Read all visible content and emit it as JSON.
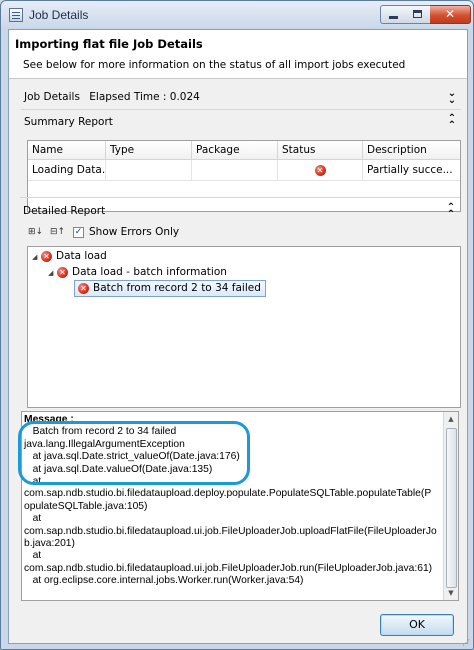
{
  "window": {
    "title": "Job Details"
  },
  "header": {
    "title": "Importing flat file Job Details",
    "description": "See below for more information on the status of all import jobs executed"
  },
  "job_details": {
    "label": "Job Details",
    "elapsed": "Elapsed Time : 0.024"
  },
  "summary": {
    "label": "Summary Report",
    "columns": [
      "Name",
      "Type",
      "Package",
      "Status",
      "Description"
    ],
    "rows": [
      {
        "name": "Loading Data...",
        "type": "",
        "package": "",
        "status_icon": "error-icon",
        "description": "Partially succe..."
      }
    ]
  },
  "detailed": {
    "label": "Detailed Report",
    "show_errors_label": "Show Errors Only",
    "show_errors_checked": true,
    "tree": [
      {
        "label": "Data load",
        "level": 0
      },
      {
        "label": "Data load - batch information",
        "level": 1
      },
      {
        "label": "Batch from record 2 to 34 failed",
        "level": 2,
        "selected": true
      }
    ]
  },
  "message": {
    "title": "Message :",
    "lines": [
      "   Batch from record 2 to 34 failed",
      "java.lang.IllegalArgumentException",
      "   at java.sql.Date.strict_valueOf(Date.java:176)",
      "   at java.sql.Date.valueOf(Date.java:135)",
      "   at",
      "com.sap.ndb.studio.bi.filedataupload.deploy.populate.PopulateSQLTable.populateTable(P",
      "opulateSQLTable.java:105)",
      "   at",
      "com.sap.ndb.studio.bi.filedataupload.ui.job.FileUploaderJob.uploadFlatFile(FileUploaderJo",
      "b.java:201)",
      "   at",
      "com.sap.ndb.studio.bi.filedataupload.ui.job.FileUploaderJob.run(FileUploaderJob.java:61)",
      "   at org.eclipse.core.internal.jobs.Worker.run(Worker.java:54)"
    ]
  },
  "buttons": {
    "ok_label": "OK"
  },
  "colors": {
    "highlight": "#1a9ad6",
    "error": "#d2301c"
  }
}
